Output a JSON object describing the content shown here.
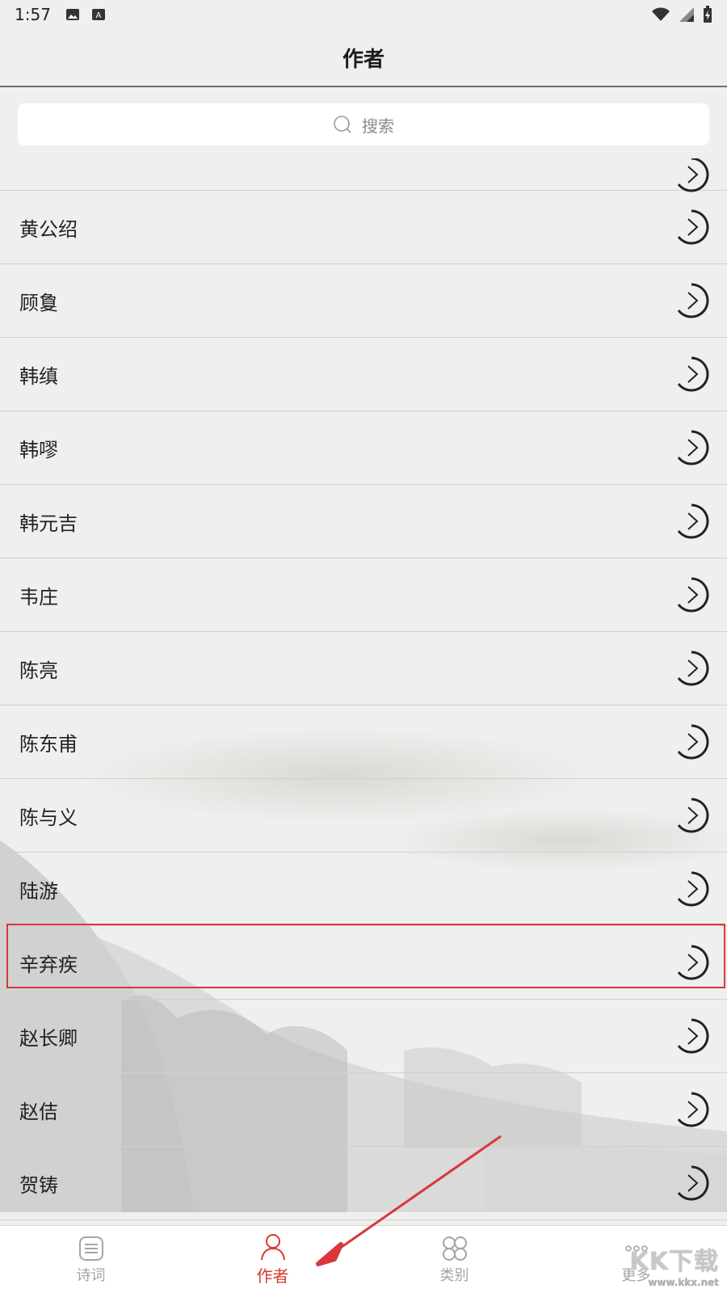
{
  "status_bar": {
    "time": "1:57"
  },
  "header": {
    "title": "作者"
  },
  "search": {
    "placeholder": "搜索"
  },
  "authors": [
    {
      "name": "黄公绍"
    },
    {
      "name": "顾敻"
    },
    {
      "name": "韩缜"
    },
    {
      "name": "韩嘐"
    },
    {
      "name": "韩元吉"
    },
    {
      "name": "韦庄"
    },
    {
      "name": "陈亮"
    },
    {
      "name": "陈东甫"
    },
    {
      "name": "陈与义"
    },
    {
      "name": "陆游"
    },
    {
      "name": "辛弃疾"
    },
    {
      "name": "赵长卿"
    },
    {
      "name": "赵佶"
    },
    {
      "name": "贺铸"
    }
  ],
  "tabs": [
    {
      "label": "诗词",
      "icon": "book-icon"
    },
    {
      "label": "作者",
      "icon": "person-icon"
    },
    {
      "label": "类别",
      "icon": "grid-icon"
    },
    {
      "label": "更多",
      "icon": "more-dots-icon"
    }
  ],
  "active_tab": "作者",
  "colors": {
    "accent": "#d53a2c",
    "annotation": "#d9373b"
  },
  "watermark": {
    "text": "KK下载",
    "sub": "www.kkx.net"
  }
}
